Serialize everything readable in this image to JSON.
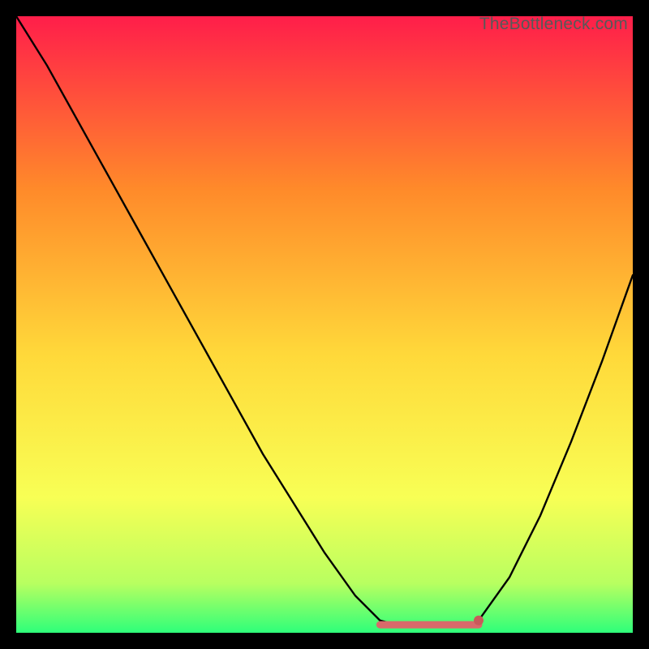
{
  "watermark": "TheBottleneck.com",
  "colors": {
    "top": "#ff1e4a",
    "upper_mid": "#ff8a2a",
    "mid": "#ffd93a",
    "lower_mid": "#f8ff55",
    "near_bottom": "#b8ff60",
    "bottom": "#2eff7a",
    "curve": "#000000",
    "flat_marker": "#d86a6a",
    "flat_marker_end": "#c85a5a"
  },
  "chart_data": {
    "type": "line",
    "title": "",
    "xlabel": "",
    "ylabel": "",
    "xlim": [
      0,
      100
    ],
    "ylim": [
      0,
      100
    ],
    "note": "Bottleneck-style curve: high at far left, drops to a flat minimum region around x≈59–75, then rises again toward the right. Y read as percent of plot height from bottom. Background is a vertical red→yellow→green gradient.",
    "series": [
      {
        "name": "curve",
        "x": [
          0,
          5,
          10,
          15,
          20,
          25,
          30,
          35,
          40,
          45,
          50,
          55,
          59,
          62,
          66,
          70,
          73,
          75,
          80,
          85,
          90,
          95,
          100
        ],
        "y": [
          100,
          92,
          83,
          74,
          65,
          56,
          47,
          38,
          29,
          21,
          13,
          6,
          2,
          1.2,
          1,
          1,
          1.2,
          2,
          9,
          19,
          31,
          44,
          58
        ]
      }
    ],
    "flat_region": {
      "x_start": 59,
      "x_end": 75,
      "y": 1.3
    },
    "flat_region_end_dot": {
      "x": 75,
      "y": 2
    }
  }
}
